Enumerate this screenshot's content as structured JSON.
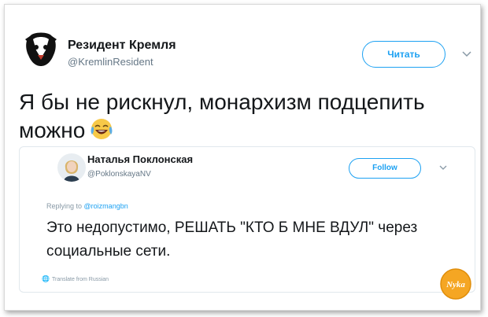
{
  "main_tweet": {
    "author_name": "Резидент Кремля",
    "author_handle": "@KremlinResident",
    "follow_label": "Читать",
    "text": "Я бы не рискнул, монархизм подцепить можно"
  },
  "quoted_tweet": {
    "author_name": "Наталья Поклонская",
    "author_handle": "@PoklonskayaNV",
    "follow_label": "Follow",
    "replying_prefix": "Replying to",
    "replying_handle": "@roizmangbn",
    "text": "Это недопустимо, РЕШАТЬ \"КТО Б МНЕ ВДУЛ\" через социальные сети.",
    "translate_label": "Translate from Russian"
  },
  "watermark": {
    "text": "Nyka"
  },
  "colors": {
    "accent": "#1da1f2",
    "muted": "#657786",
    "logo": "#f5a623"
  },
  "icons": {
    "main_avatar": "badger-avatar-icon",
    "emoji": "laughing-crying-emoji-icon",
    "chevron": "chevron-down-icon",
    "globe": "globe-icon"
  }
}
